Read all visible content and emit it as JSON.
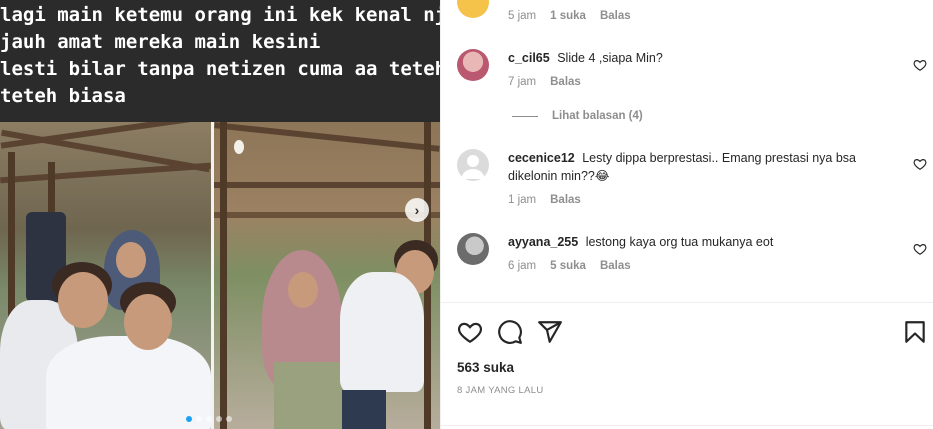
{
  "post": {
    "caption_lines": [
      "lagi main ketemu orang ini kek kenal njir",
      "jauh amat mereka main kesini",
      "lesti bilar tanpa netizen cuma aa teteh",
      "teteh biasa"
    ],
    "carousel": {
      "slides": 5,
      "active_index": 0
    }
  },
  "comments": {
    "top_partial": {
      "time": "5 jam",
      "likes": "1 suka",
      "reply": "Balas"
    },
    "items": [
      {
        "username": "c_cil65",
        "text": "Slide 4 ,siapa Min?",
        "time": "7 jam",
        "likes": "",
        "reply": "Balas"
      },
      {
        "username": "cecenice12",
        "text": "Lesty dippa berprestasi.. Emang prestasi nya bsa dikelonin min??😂",
        "time": "1 jam",
        "likes": "",
        "reply": "Balas"
      },
      {
        "username": "ayyana_255",
        "text": "lestong kaya org tua mukanya eot",
        "time": "6 jam",
        "likes": "5 suka",
        "reply": "Balas"
      }
    ],
    "view_replies": "Lihat balasan (4)"
  },
  "actions": {
    "likes_count": "563 suka",
    "time_ago": "8 JAM YANG LALU"
  },
  "icons": [
    "heart-icon",
    "comment-icon",
    "share-icon",
    "bookmark-icon",
    "next-arrow-icon"
  ],
  "colors": {
    "accent": "#1aa1f2",
    "text": "#262626",
    "muted": "#8e8e8e"
  }
}
